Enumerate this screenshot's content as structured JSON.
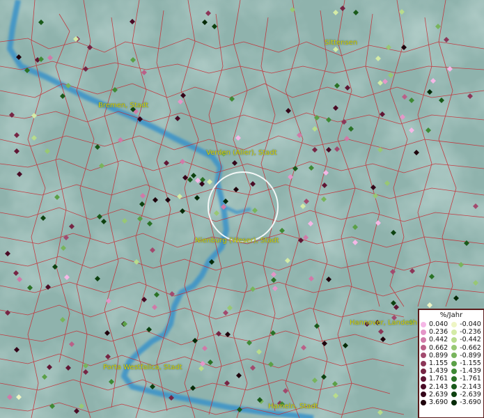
{
  "map": {
    "place_labels": [
      {
        "text": "Sittensen",
        "id": "sittensen"
      },
      {
        "text": "Bremen, Stadt",
        "id": "bremen"
      },
      {
        "text": "Verden (Aller), Stadt",
        "id": "verden"
      },
      {
        "text": "Nienburg (Weser), Stadt",
        "id": "nienburg"
      },
      {
        "text": "Hannover, Landesh",
        "id": "hannover"
      },
      {
        "text": "Porta Westfalica, Stadt",
        "id": "porta"
      },
      {
        "text": "Hameln, Stadt",
        "id": "hameln"
      }
    ],
    "colors": {
      "background": "#8fb3ad",
      "river": "#3d93c8",
      "boundaries": "#c8262e",
      "label": "#d9d400",
      "focus_circle": "#ffffff"
    }
  },
  "legend": {
    "title": "%/Jahr",
    "positive": [
      {
        "label": "0.040",
        "color": "#f5b7e6"
      },
      {
        "label": "0.236",
        "color": "#e496c8"
      },
      {
        "label": "0.442",
        "color": "#d07aa8"
      },
      {
        "label": "0.662",
        "color": "#ba6088"
      },
      {
        "label": "0.899",
        "color": "#a24a6e"
      },
      {
        "label": "1.155",
        "color": "#8c3658"
      },
      {
        "label": "1.439",
        "color": "#762544"
      },
      {
        "label": "1.761",
        "color": "#601634"
      },
      {
        "label": "2.143",
        "color": "#4a0c26"
      },
      {
        "label": "2.639",
        "color": "#340519"
      },
      {
        "label": "3.690",
        "color": "#1f020c"
      }
    ],
    "negative": [
      {
        "label": "-0.040",
        "color": "#eef5c4"
      },
      {
        "label": "-0.236",
        "color": "#d4eba6"
      },
      {
        "label": "-0.442",
        "color": "#b8dc8c"
      },
      {
        "label": "-0.662",
        "color": "#98c874"
      },
      {
        "label": "-0.899",
        "color": "#78b45c"
      },
      {
        "label": "-1.155",
        "color": "#5ba047"
      },
      {
        "label": "-1.439",
        "color": "#3f8a35"
      },
      {
        "label": "-1.761",
        "color": "#2a7226"
      },
      {
        "label": "-2.143",
        "color": "#1a5a1a"
      },
      {
        "label": "-2.639",
        "color": "#0e4210"
      },
      {
        "label": "-3.690",
        "color": "#052a07"
      }
    ]
  }
}
